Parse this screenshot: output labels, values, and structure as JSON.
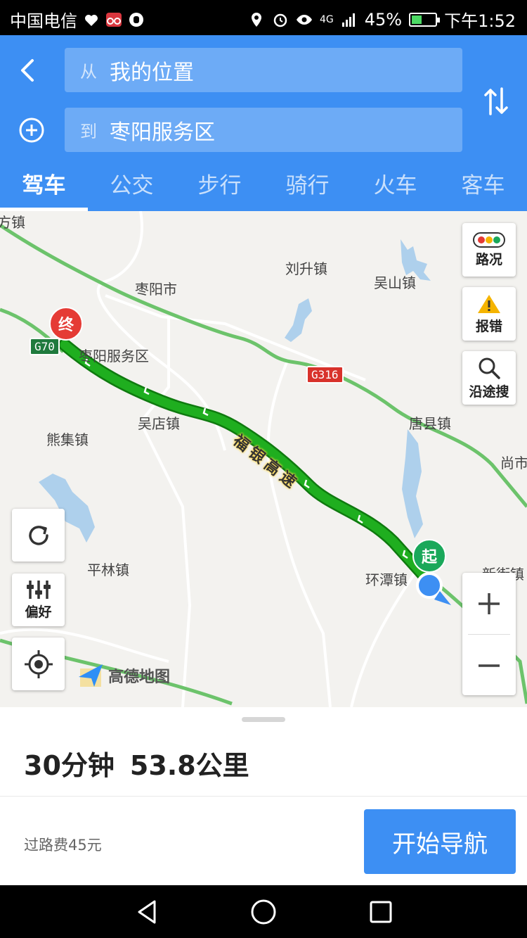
{
  "status_bar": {
    "carrier": "中国电信",
    "network": "4G",
    "battery": "45%",
    "battery_level": 0.45,
    "time": "下午1:52"
  },
  "header": {
    "from": {
      "prefix": "从",
      "value": "我的位置"
    },
    "to": {
      "prefix": "到",
      "value": "枣阳服务区"
    },
    "tabs": [
      {
        "label": "驾车",
        "active": true
      },
      {
        "label": "公交",
        "active": false
      },
      {
        "label": "步行",
        "active": false
      },
      {
        "label": "骑行",
        "active": false
      },
      {
        "label": "火车",
        "active": false
      },
      {
        "label": "客车",
        "active": false
      }
    ]
  },
  "map": {
    "places": [
      "方镇",
      "刘升镇",
      "吴山镇",
      "枣阳市",
      "枣阳服务区",
      "吴店镇",
      "唐县镇",
      "熊集镇",
      "尚市",
      "平林镇",
      "环潭镇",
      "新街镇"
    ],
    "road_shields": [
      "G70",
      "G316"
    ],
    "route_label": "福银高速",
    "end_pin": "终",
    "start_pin": "起",
    "controls": {
      "traffic": "路况",
      "report": "报错",
      "search_along": "沿途搜",
      "preference": "偏好"
    },
    "brand": "高德地图",
    "colors": {
      "route": "#1fae1f",
      "accent": "#3d8ff3",
      "end_pin": "#e53b35",
      "start_pin": "#1aa85a"
    }
  },
  "panel": {
    "duration": "30分钟",
    "distance": "53.8公里",
    "toll": "过路费45元",
    "start_nav": "开始导航"
  }
}
